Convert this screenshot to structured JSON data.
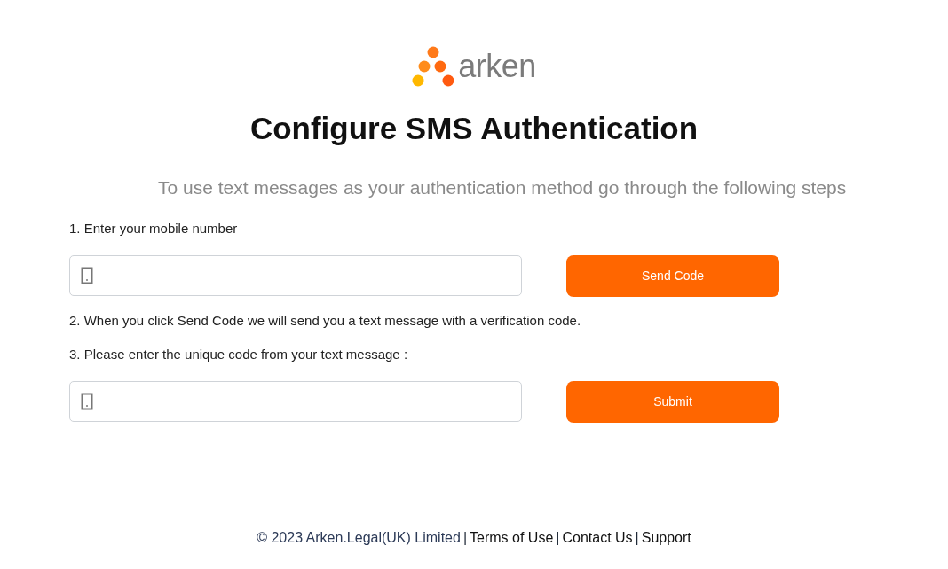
{
  "logo": {
    "text": "arken"
  },
  "title": "Configure SMS Authentication",
  "subtitle": "To use text messages as your authentication method go through the following steps",
  "steps": [
    {
      "kind": "field",
      "label": "1. Enter your mobile number",
      "button": "Send Code"
    },
    {
      "kind": "note",
      "label": "2. When you click Send Code we will send you a text message with a verification code."
    },
    {
      "kind": "field",
      "label": "3. Please enter the unique code from your text message :",
      "button": "Submit"
    }
  ],
  "footer": {
    "copyright": "© 2023 Arken.Legal(UK) Limited",
    "separators": [
      "|",
      "|",
      "|"
    ],
    "links": [
      "Terms of Use",
      "Contact Us",
      "Support"
    ]
  }
}
